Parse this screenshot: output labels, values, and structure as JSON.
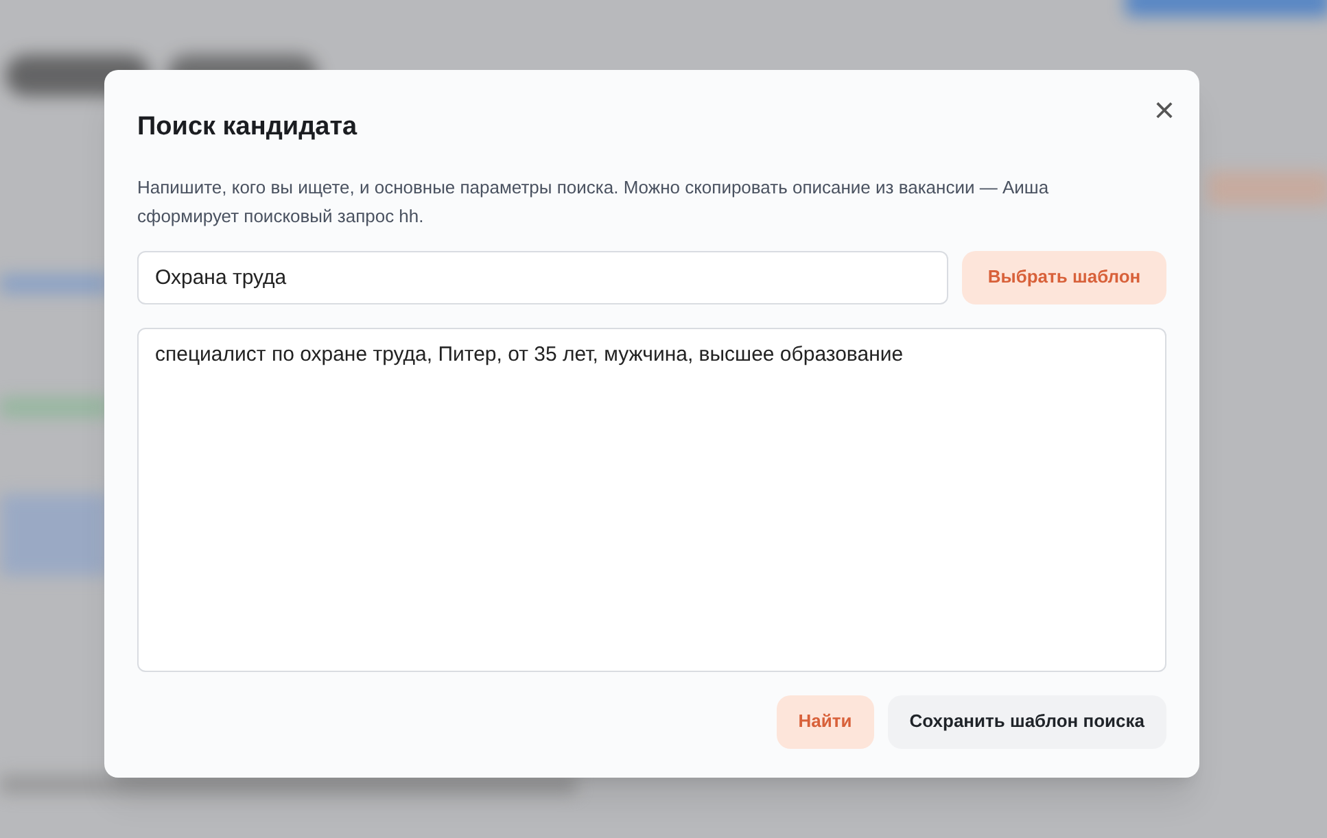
{
  "dialog": {
    "title": "Поиск кандидата",
    "close_icon": "×",
    "description": "Напишите, кого вы ищете, и основные параметры поиска. Можно скопировать описание из вакансии — Аиша сформирует поисковый запрос hh.",
    "title_field": {
      "value": "Охрана труда"
    },
    "template_button": "Выбрать шаблон",
    "query_field": {
      "value": "специалист по охране труда, Питер, от 35 лет, мужчина, высшее образование"
    },
    "buttons": [
      {
        "label": "Найти",
        "kind": "primary"
      },
      {
        "label": "Сохранить шаблон поиска",
        "kind": "secondary"
      }
    ]
  }
}
